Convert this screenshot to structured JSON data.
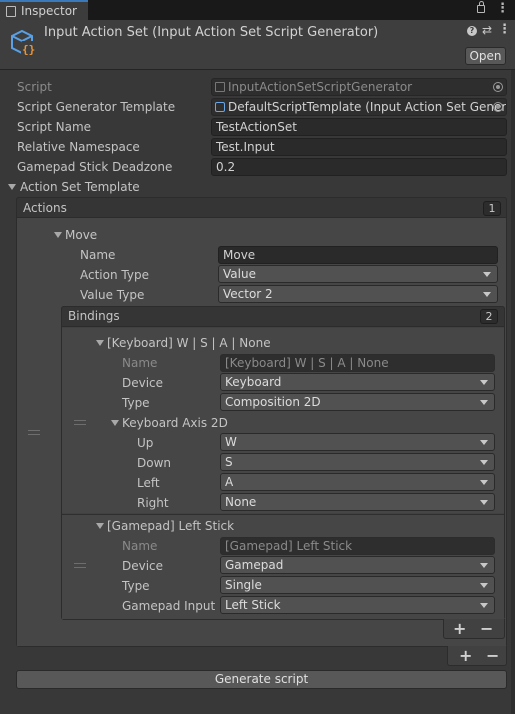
{
  "tab": {
    "title": "Inspector"
  },
  "header": {
    "title": "Input Action Set (Input Action Set Script Generator)",
    "open_label": "Open"
  },
  "props": {
    "script_label": "Script",
    "script_value": "InputActionSetScriptGenerator",
    "template_label": "Script Generator Template",
    "template_value": "DefaultScriptTemplate (Input Action Set Genera",
    "name_label": "Script Name",
    "name_value": "TestActionSet",
    "namespace_label": "Relative Namespace",
    "namespace_value": "Test.Input",
    "deadzone_label": "Gamepad Stick Deadzone",
    "deadzone_value": "0.2",
    "action_set_template_label": "Action Set Template"
  },
  "actions": {
    "header": "Actions",
    "count": "1",
    "move": {
      "label": "Move",
      "name_label": "Name",
      "name_value": "Move",
      "action_type_label": "Action Type",
      "action_type_value": "Value",
      "value_type_label": "Value Type",
      "value_type_value": "Vector 2",
      "bindings": {
        "header": "Bindings",
        "count": "2",
        "keyboard": {
          "label": "[Keyboard] W | S | A | None",
          "name_label": "Name",
          "name_value": "[Keyboard] W | S | A | None",
          "device_label": "Device",
          "device_value": "Keyboard",
          "type_label": "Type",
          "type_value": "Composition 2D",
          "axis_label": "Keyboard Axis 2D",
          "up_label": "Up",
          "up_value": "W",
          "down_label": "Down",
          "down_value": "S",
          "left_label": "Left",
          "left_value": "A",
          "right_label": "Right",
          "right_value": "None"
        },
        "gamepad": {
          "label": "[Gamepad] Left Stick",
          "name_label": "Name",
          "name_value": "[Gamepad] Left Stick",
          "device_label": "Device",
          "device_value": "Gamepad",
          "type_label": "Type",
          "type_value": "Single",
          "input_label": "Gamepad Input",
          "input_value": "Left Stick"
        }
      }
    }
  },
  "buttons": {
    "plus": "+",
    "minus": "−",
    "generate": "Generate script"
  },
  "colors": {
    "background": "#383838",
    "field": "#2a2a2a",
    "dropdown": "#515151",
    "tab": "#3c3c3c"
  },
  "icons": [
    "inspector-tab-icon",
    "lock-icon",
    "kebab-menu-icon",
    "script-asset-icon",
    "help-icon",
    "presets-icon",
    "object-picker-icon"
  ]
}
